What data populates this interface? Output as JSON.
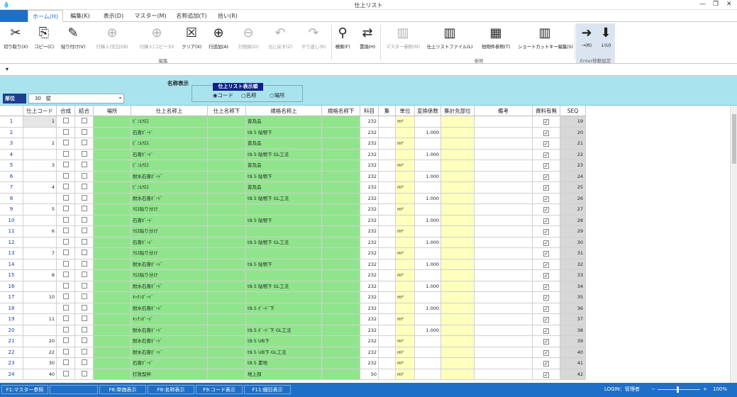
{
  "window": {
    "title": "仕上リスト"
  },
  "tabs": [
    {
      "label": "ホーム(H)",
      "active": true
    },
    {
      "label": "編集(K)"
    },
    {
      "label": "表示(D)"
    },
    {
      "label": "マスター(M)"
    },
    {
      "label": "名称追加(T)"
    },
    {
      "label": "拾い(R)"
    }
  ],
  "ribbon": {
    "buttons": [
      {
        "label": "切り取り(X)",
        "icon": "scissors-icon",
        "glyph": "✂",
        "enabled": true
      },
      {
        "label": "コピー(C)",
        "icon": "copy-icon",
        "glyph": "⎘",
        "enabled": true
      },
      {
        "label": "貼り付け(V)",
        "icon": "paste-icon",
        "glyph": "✎",
        "enabled": true
      },
      {
        "label": "行挿入(空白)(B)",
        "icon": "insert-row-blank-icon",
        "glyph": "⊕",
        "enabled": false
      },
      {
        "label": "行挿入(コピー)(I)",
        "icon": "insert-row-copy-icon",
        "glyph": "⊕",
        "enabled": false
      },
      {
        "label": "クリア(X)",
        "icon": "clear-icon",
        "glyph": "☒",
        "enabled": true
      },
      {
        "label": "行追加(A)",
        "icon": "add-row-icon",
        "glyph": "⊕",
        "enabled": true
      },
      {
        "label": "行削除(D)",
        "icon": "delete-row-icon",
        "glyph": "⊖",
        "enabled": false
      },
      {
        "label": "元に戻す(Z)",
        "icon": "undo-icon",
        "glyph": "↶",
        "enabled": false
      },
      {
        "label": "やり直し(R)",
        "icon": "redo-icon",
        "glyph": "↷",
        "enabled": false
      },
      {
        "label": "検索(F)",
        "icon": "search-icon",
        "glyph": "⚲",
        "enabled": true
      },
      {
        "label": "置換(H)",
        "icon": "replace-icon",
        "glyph": "⇄",
        "enabled": true
      },
      {
        "label": "マスター参照(M)",
        "icon": "master-ref-book-icon",
        "glyph": "▥",
        "enabled": false
      },
      {
        "label": "仕上リストファイル(L)",
        "icon": "list-file-book-icon",
        "glyph": "▥",
        "enabled": true
      },
      {
        "label": "他物件参照(T)",
        "icon": "other-project-grid-icon",
        "glyph": "▦",
        "enabled": true
      },
      {
        "label": "ショートカットキー編集(S)",
        "icon": "shortcut-book-icon",
        "glyph": "▥",
        "enabled": true
      },
      {
        "label": "→(R)",
        "icon": "arrow-right-icon",
        "glyph": "➜",
        "enabled": true
      },
      {
        "label": "↓(U)",
        "icon": "arrow-down-icon",
        "glyph": "⬇",
        "enabled": true
      }
    ],
    "groups": {
      "edit": "編集",
      "reference": "参照",
      "enter": "Enter移動設定"
    }
  },
  "panel": {
    "name_display_label": "名称表示",
    "name_display_title": "仕上リスト表示順",
    "radio_options": [
      "コード",
      "名称",
      "場所"
    ],
    "radio_selected": "コード",
    "bui_label": "部位",
    "bui_value": "30　壁"
  },
  "grid": {
    "headers": [
      "",
      "仕上コード",
      "合成",
      "結合",
      "場所",
      "仕上名称上",
      "仕上名称下",
      "規格名称上",
      "規格名称下",
      "科目",
      "集",
      "単位",
      "変換係数",
      "集計先部位",
      "備考",
      "資料有無",
      "SEQ"
    ],
    "rows": [
      {
        "n": "1",
        "code": "1",
        "n_up": "ﾋﾞﾆﾙｸﾛｽ",
        "k_up": "普及品",
        "kamoku": "232",
        "unit": "m²",
        "factor": "",
        "mat": true,
        "seq": "19"
      },
      {
        "n": "2",
        "code": "",
        "n_up": "石膏ﾎﾞｰﾄﾞ",
        "k_up": "t9.5 貼物下",
        "kamoku": "232",
        "unit": "",
        "factor": "1.000",
        "mat": true,
        "seq": "20"
      },
      {
        "n": "3",
        "code": "2",
        "n_up": "ﾋﾞﾆﾙｸﾛｽ",
        "k_up": "普及品",
        "kamoku": "232",
        "unit": "m²",
        "factor": "",
        "mat": true,
        "seq": "21"
      },
      {
        "n": "4",
        "code": "",
        "n_up": "石膏ﾎﾞｰﾄﾞ",
        "k_up": "t9.5 貼物下 GL工法",
        "kamoku": "232",
        "unit": "",
        "factor": "1.000",
        "mat": true,
        "seq": "22"
      },
      {
        "n": "5",
        "code": "3",
        "n_up": "ﾋﾞﾆﾙｸﾛｽ",
        "k_up": "普及品",
        "kamoku": "232",
        "unit": "m²",
        "factor": "",
        "mat": true,
        "seq": "23"
      },
      {
        "n": "6",
        "code": "",
        "n_up": "耐水石膏ﾎﾞｰﾄﾞ",
        "k_up": "t9.5 貼物下",
        "kamoku": "232",
        "unit": "",
        "factor": "1.000",
        "mat": true,
        "seq": "24"
      },
      {
        "n": "7",
        "code": "4",
        "n_up": "ﾋﾞﾆﾙｸﾛｽ",
        "k_up": "普及品",
        "kamoku": "232",
        "unit": "m²",
        "factor": "",
        "mat": true,
        "seq": "25"
      },
      {
        "n": "8",
        "code": "",
        "n_up": "耐水石膏ﾎﾞｰﾄﾞ",
        "k_up": "t9.5 貼物下 GL工法",
        "kamoku": "232",
        "unit": "",
        "factor": "1.000",
        "mat": true,
        "seq": "26"
      },
      {
        "n": "9",
        "code": "5",
        "n_up": "ｸﾛｽ貼り分け",
        "k_up": "",
        "kamoku": "232",
        "unit": "m²",
        "factor": "",
        "mat": true,
        "seq": "27"
      },
      {
        "n": "10",
        "code": "",
        "n_up": "石膏ﾎﾞｰﾄﾞ",
        "k_up": "t9.5 貼物下",
        "kamoku": "232",
        "unit": "",
        "factor": "1.000",
        "mat": true,
        "seq": "28"
      },
      {
        "n": "11",
        "code": "6",
        "n_up": "ｸﾛｽ貼り分け",
        "k_up": "",
        "kamoku": "232",
        "unit": "m²",
        "factor": "",
        "mat": true,
        "seq": "29"
      },
      {
        "n": "12",
        "code": "",
        "n_up": "石膏ﾎﾞｰﾄﾞ",
        "k_up": "t9.5 貼物下 GL工法",
        "kamoku": "232",
        "unit": "",
        "factor": "1.000",
        "mat": true,
        "seq": "30"
      },
      {
        "n": "13",
        "code": "7",
        "n_up": "ｸﾛｽ貼り分け",
        "k_up": "",
        "kamoku": "232",
        "unit": "m²",
        "factor": "",
        "mat": true,
        "seq": "31"
      },
      {
        "n": "14",
        "code": "",
        "n_up": "耐水石膏ﾎﾞｰﾄﾞ",
        "k_up": "t9.5 貼物下",
        "kamoku": "232",
        "unit": "",
        "factor": "1.000",
        "mat": true,
        "seq": "32"
      },
      {
        "n": "15",
        "code": "8",
        "n_up": "ｸﾛｽ貼り分け",
        "k_up": "",
        "kamoku": "232",
        "unit": "m²",
        "factor": "",
        "mat": true,
        "seq": "33"
      },
      {
        "n": "16",
        "code": "",
        "n_up": "耐水石膏ﾎﾞｰﾄﾞ",
        "k_up": "t9.5 貼物下 GL工法",
        "kamoku": "232",
        "unit": "",
        "factor": "1.000",
        "mat": true,
        "seq": "34"
      },
      {
        "n": "17",
        "code": "10",
        "n_up": "ｷｯﾁﾝﾎﾞｰﾄﾞ",
        "k_up": "",
        "kamoku": "232",
        "unit": "m²",
        "factor": "",
        "mat": true,
        "seq": "35"
      },
      {
        "n": "18",
        "code": "",
        "n_up": "耐水石膏ﾎﾞｰﾄﾞ",
        "k_up": "t9.5 ﾎﾞｰﾄﾞ下",
        "kamoku": "232",
        "unit": "",
        "factor": "1.000",
        "mat": true,
        "seq": "36"
      },
      {
        "n": "19",
        "code": "11",
        "n_up": "ｷｯﾁﾝﾎﾞｰﾄﾞ",
        "k_up": "",
        "kamoku": "232",
        "unit": "m²",
        "factor": "",
        "mat": true,
        "seq": "37"
      },
      {
        "n": "20",
        "code": "",
        "n_up": "耐水石膏ﾎﾞｰﾄﾞ",
        "k_up": "t9.5 ﾎﾞｰﾄﾞ下 GL工法",
        "kamoku": "232",
        "unit": "",
        "factor": "1.000",
        "mat": true,
        "seq": "38"
      },
      {
        "n": "21",
        "code": "20",
        "n_up": "耐水石膏ﾎﾞｰﾄﾞ",
        "k_up": "t9.5 UB下",
        "kamoku": "232",
        "unit": "m²",
        "factor": "",
        "mat": true,
        "seq": "39"
      },
      {
        "n": "22",
        "code": "22",
        "n_up": "耐水石膏ﾎﾞｰﾄﾞ",
        "k_up": "t9.5 UB下 GL工法",
        "kamoku": "232",
        "unit": "m²",
        "factor": "",
        "mat": true,
        "seq": "40"
      },
      {
        "n": "23",
        "code": "30",
        "n_up": "石膏ﾎﾞｰﾄﾞ",
        "k_up": "t9.5 素地",
        "kamoku": "232",
        "unit": "m²",
        "factor": "",
        "mat": true,
        "seq": "41"
      },
      {
        "n": "24",
        "code": "40",
        "n_up": "打放型枠",
        "k_up": "地上部",
        "kamoku": "50",
        "unit": "m²",
        "factor": "",
        "mat": true,
        "seq": "42"
      }
    ]
  },
  "statusbar": {
    "keys": [
      "F1:マスター参照",
      "",
      "F6:単価表示",
      "F8:名称表示",
      "F9:コード表示",
      "F11:細目表示"
    ],
    "login": "LOGIN：管理者",
    "zoom": "100%"
  },
  "colors": {
    "accent": "#1e6fc7",
    "panel": "#a9e4ee",
    "green_cell": "#90e58c",
    "yellow_cell": "#ffffbe",
    "seq_cell": "#d7d7d7"
  }
}
